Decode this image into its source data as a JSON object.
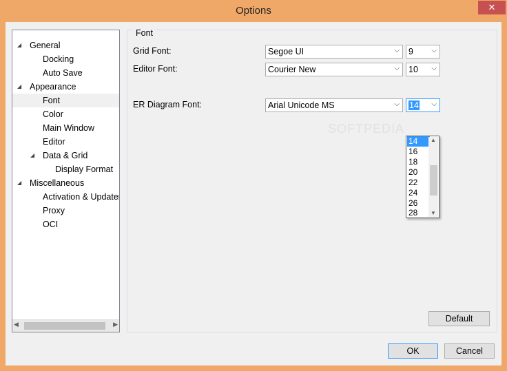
{
  "window": {
    "title": "Options",
    "close_label": "✕"
  },
  "tree": {
    "items": [
      {
        "label": "General",
        "arrow": "◢"
      },
      {
        "label": "Docking"
      },
      {
        "label": "Auto Save"
      },
      {
        "label": "Appearance",
        "arrow": "◢"
      },
      {
        "label": "Font"
      },
      {
        "label": "Color"
      },
      {
        "label": "Main Window"
      },
      {
        "label": "Editor"
      },
      {
        "label": "Data & Grid",
        "arrow": "◢"
      },
      {
        "label": "Display Format"
      },
      {
        "label": "Miscellaneous",
        "arrow": "◢"
      },
      {
        "label": "Activation & Updater"
      },
      {
        "label": "Proxy"
      },
      {
        "label": "OCI"
      }
    ]
  },
  "font_group": {
    "title": "Font",
    "grid_font_label": "Grid Font:",
    "grid_font_value": "Segoe UI",
    "grid_size_value": "9",
    "editor_font_label": "Editor Font:",
    "editor_font_value": "Courier New",
    "editor_size_value": "10",
    "er_font_label": "ER Diagram Font:",
    "er_font_value": "Arial Unicode MS",
    "er_size_value": "14",
    "size_options": [
      "14",
      "16",
      "18",
      "20",
      "22",
      "24",
      "26",
      "28"
    ]
  },
  "buttons": {
    "default": "Default",
    "ok": "OK",
    "cancel": "Cancel"
  },
  "watermark": "SOFTPEDIA",
  "icons": {
    "chevron": "chevron-down-icon"
  }
}
